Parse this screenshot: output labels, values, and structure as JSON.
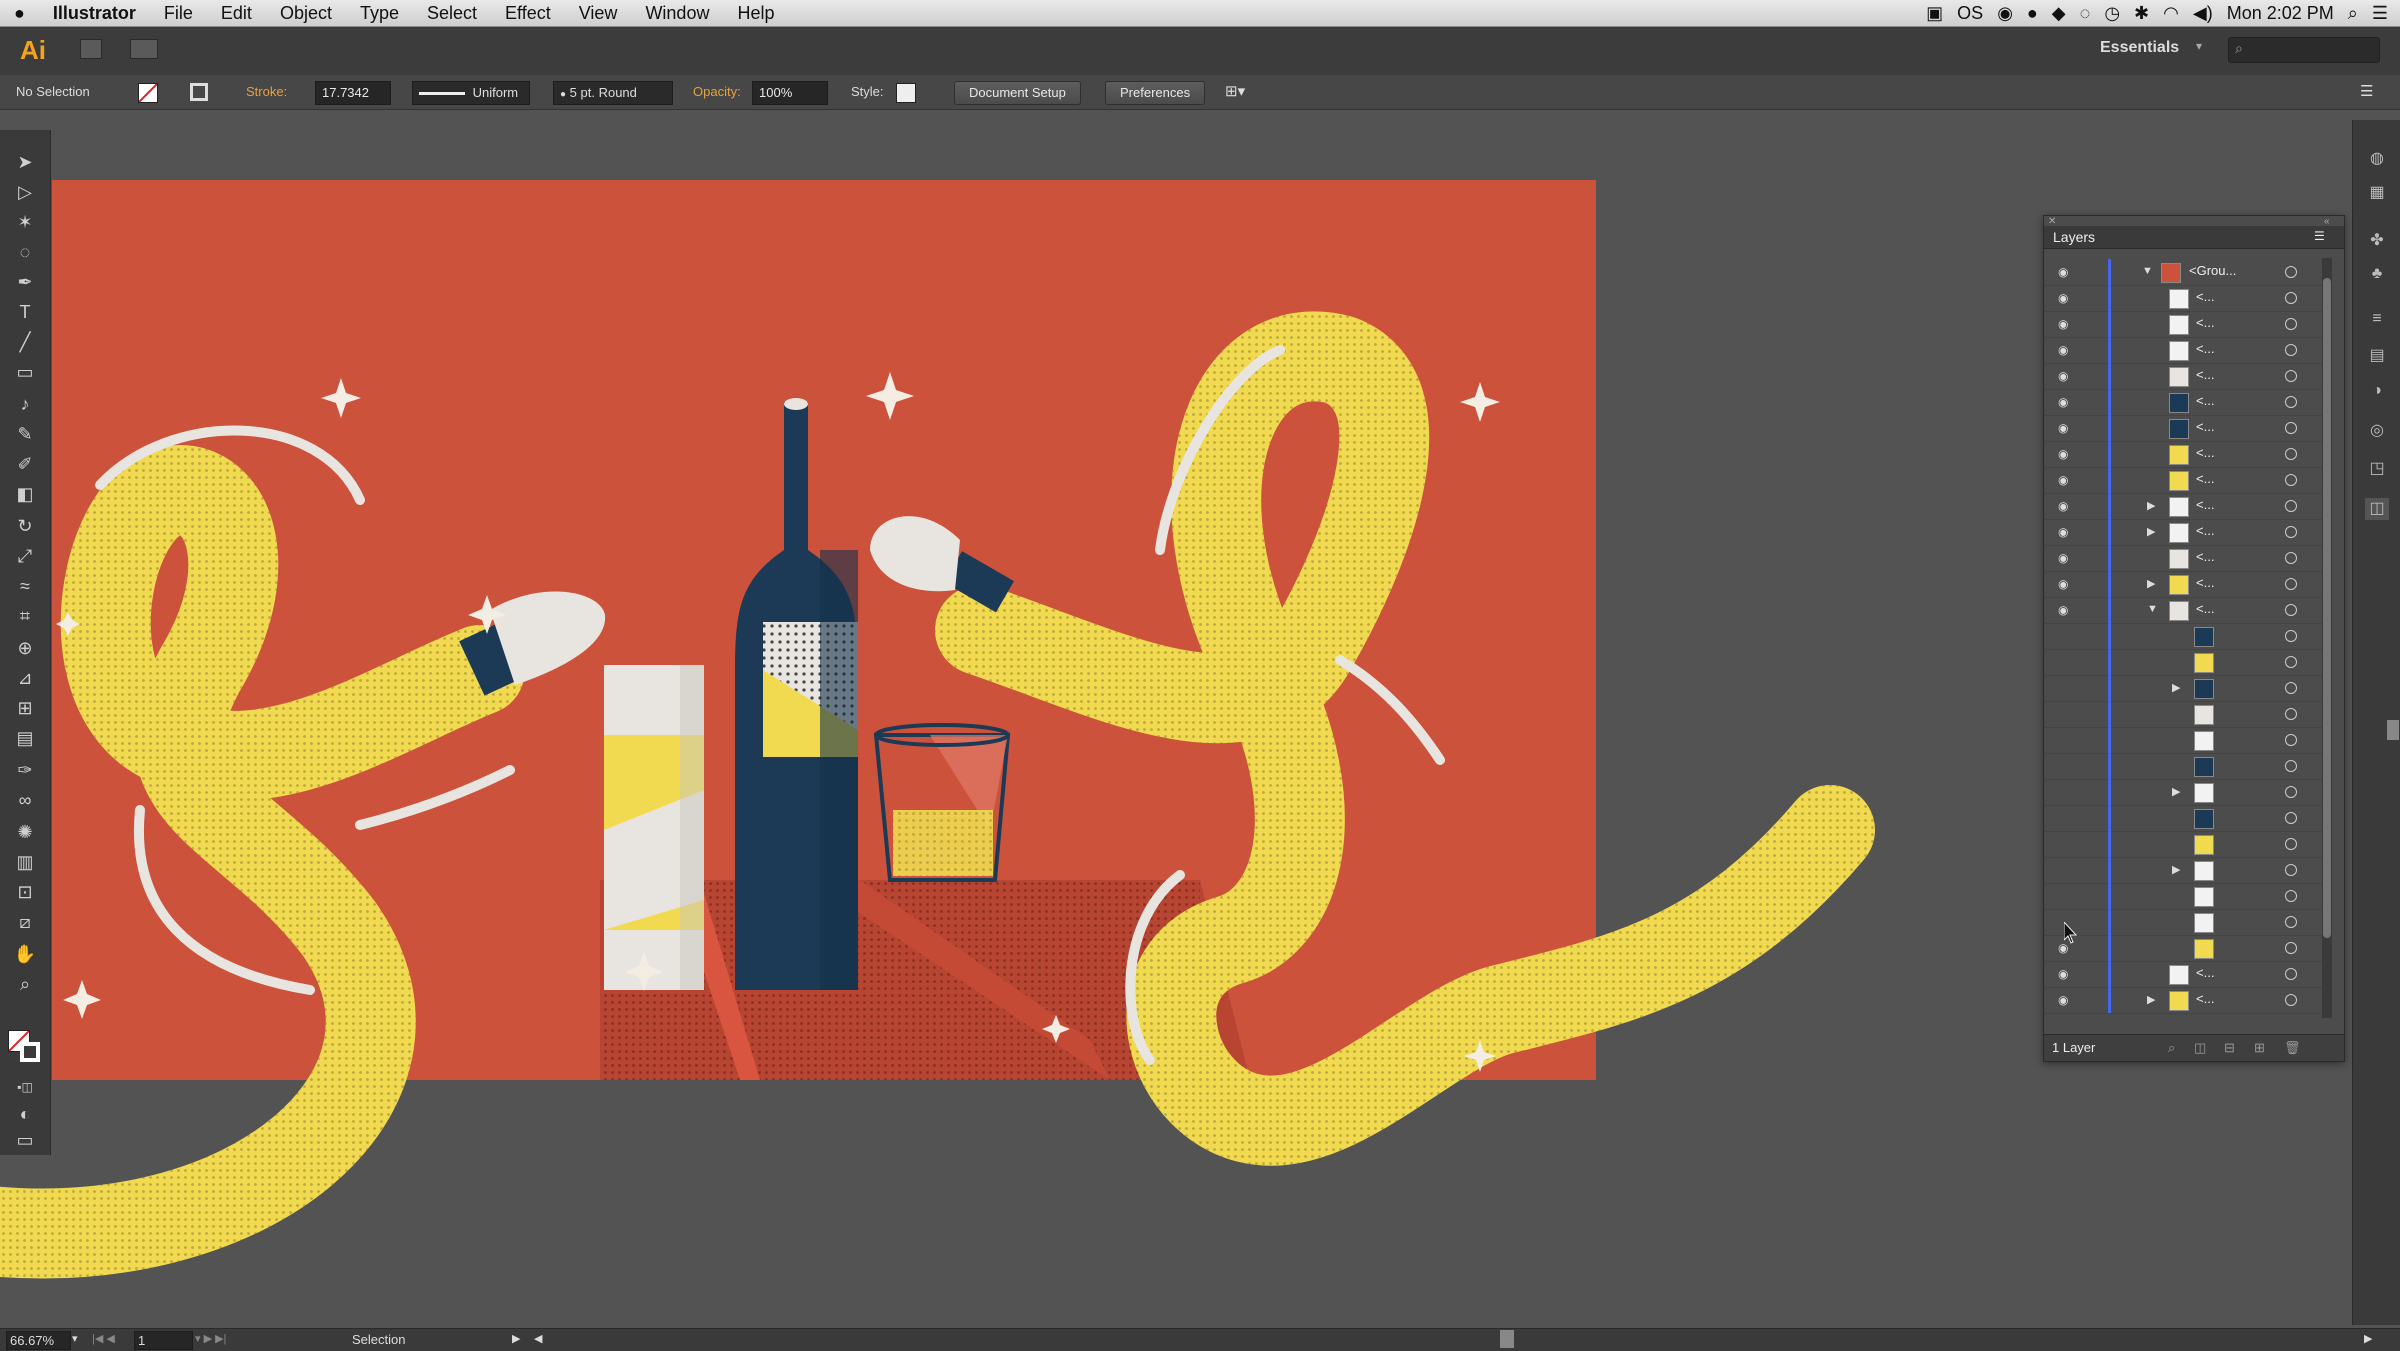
{
  "menubar": {
    "app": "Illustrator",
    "items": [
      "File",
      "Edit",
      "Object",
      "Type",
      "Select",
      "Effect",
      "View",
      "Window",
      "Help"
    ],
    "os_label": "OS",
    "clock": "Mon 2:02 PM"
  },
  "appbar": {
    "logo": "Ai",
    "workspace": "Essentials"
  },
  "controlbar": {
    "selection": "No Selection",
    "stroke_label": "Stroke:",
    "stroke_value": "17.7342",
    "profile": "Uniform",
    "brush": "5 pt. Round",
    "opacity_label": "Opacity:",
    "opacity_value": "100%",
    "style_label": "Style:",
    "doc_setup": "Document Setup",
    "preferences": "Preferences"
  },
  "layers": {
    "title": "Layers",
    "footer": "1 Layer",
    "group_name": "<Grou...",
    "item_name": "<..."
  },
  "status": {
    "zoom": "66.67%",
    "page": "1",
    "tool": "Selection"
  },
  "colors": {
    "artboard": "#cc523c",
    "yellow": "#f1da4f",
    "navy": "#1c3a55",
    "offwhite": "#e8e4df"
  }
}
